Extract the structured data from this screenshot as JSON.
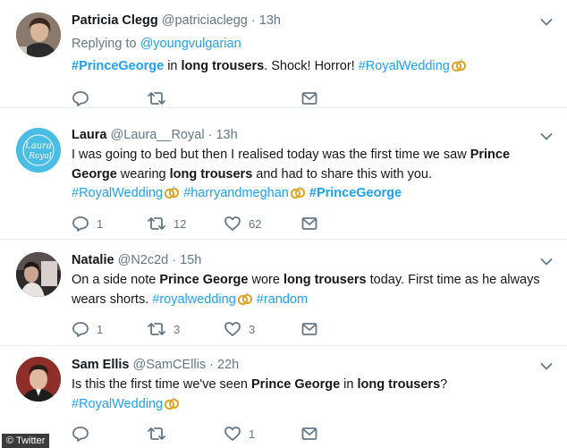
{
  "tweets": [
    {
      "name": "Patricia Clegg",
      "handle": "@patriciaclegg",
      "separator": "·",
      "time": "13h",
      "replying_prefix": "Replying to",
      "replying_to": "@youngvulgarian",
      "segments": {
        "s1": "#PrinceGeorge",
        "s2": " in ",
        "s3": "long trousers",
        "s4": ". Shock! Horror! ",
        "s5": "#RoyalWedding"
      },
      "retweets": "",
      "likes": "",
      "replies": ""
    },
    {
      "name": "Laura",
      "handle": "@Laura__Royal",
      "separator": "·",
      "time": "13h",
      "avatar_text": "Laura Royal",
      "segments": {
        "s1": "I was going to bed but then I realised today was the first time we saw ",
        "s2": "Prince George",
        "s3": " wearing ",
        "s4": "long trousers",
        "s5": " and had to share this with you.",
        "s6": "#RoyalWedding",
        "s7": "#harryandmeghan",
        "s8": "#PrinceGeorge"
      },
      "replies": "1",
      "retweets": "12",
      "likes": "62"
    },
    {
      "name": "Natalie",
      "handle": "@N2c2d",
      "separator": "·",
      "time": "15h",
      "segments": {
        "s1": "On a side note ",
        "s2": "Prince George",
        "s3": " wore ",
        "s4": "long trousers",
        "s5": " today. First time as he always wears shorts. ",
        "s6": "#royalwedding",
        "s7": "#random"
      },
      "replies": "1",
      "retweets": "3",
      "likes": "3"
    },
    {
      "name": "Sam Ellis",
      "handle": "@SamCEllis",
      "separator": "·",
      "time": "22h",
      "segments": {
        "s1": "Is this the first time we've seen ",
        "s2": "Prince George",
        "s3": " in ",
        "s4": "long trousers",
        "s5": "?",
        "s6": "#RoyalWedding"
      },
      "replies": "",
      "retweets": "",
      "likes": "1"
    }
  ],
  "credit": "© Twitter",
  "colors": {
    "link": "#1da1f2",
    "muted": "#657786",
    "text": "#14171a",
    "ring_gold": "#e0a52b"
  },
  "icons": [
    "reply-icon",
    "retweet-icon",
    "like-icon",
    "message-icon",
    "chevron-down-icon",
    "wedding-rings-icon"
  ]
}
